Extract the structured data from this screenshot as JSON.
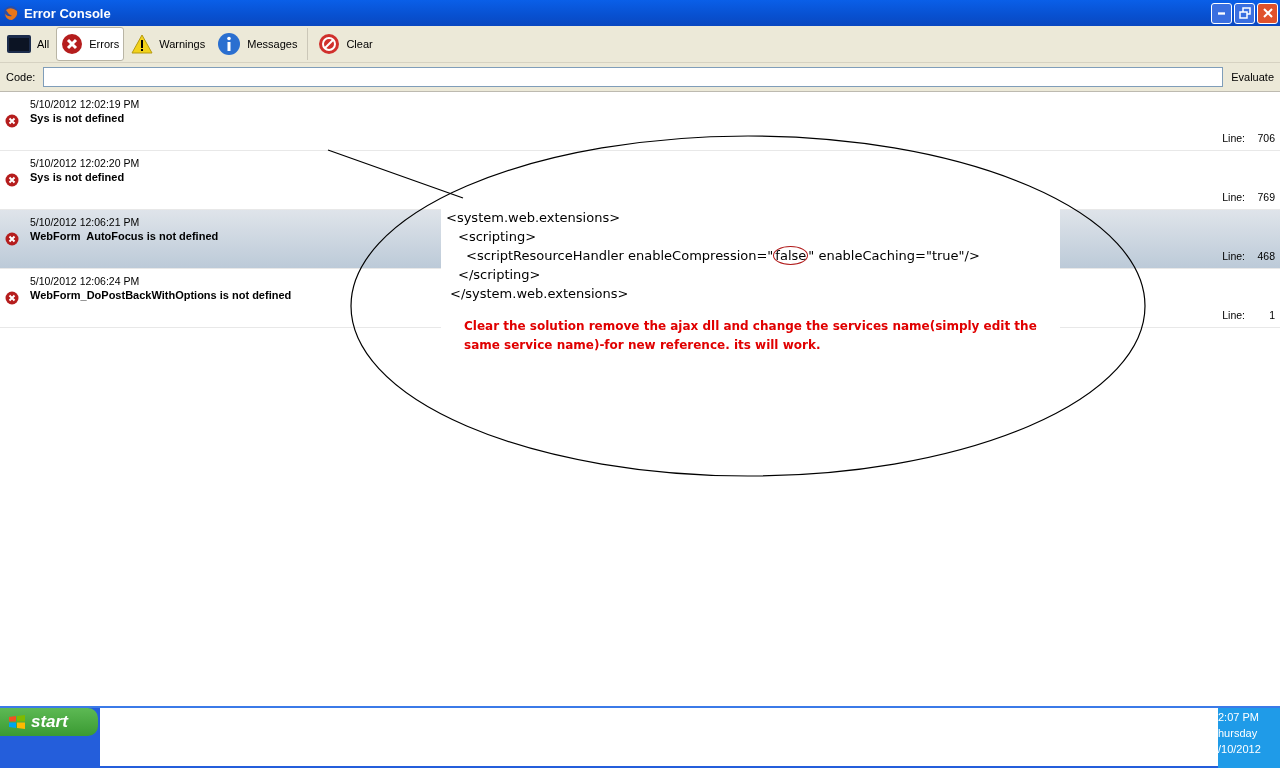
{
  "window": {
    "title": "Error Console"
  },
  "toolbar": [
    {
      "kind": "all",
      "label": "All",
      "selected": false
    },
    {
      "kind": "errors",
      "label": "Errors",
      "selected": true
    },
    {
      "kind": "warnings",
      "label": "Warnings",
      "selected": false
    },
    {
      "kind": "messages",
      "label": "Messages",
      "selected": false
    },
    {
      "kind": "clear",
      "label": "Clear",
      "selected": false
    }
  ],
  "code_bar": {
    "label": "Code:",
    "button": "Evaluate"
  },
  "messages": [
    {
      "time": "5/10/2012 12:02:19 PM",
      "text": "Sys is not defined",
      "line_label": "Line:",
      "line": "706",
      "selected": false
    },
    {
      "time": "5/10/2012 12:02:20 PM",
      "text": "Sys is not defined",
      "line_label": "Line:",
      "line": "769",
      "selected": false
    },
    {
      "time": "5/10/2012 12:06:21 PM",
      "text": "WebForm  AutoFocus is not defined",
      "line_label": "Line:",
      "line": "468",
      "selected": true
    },
    {
      "time": "5/10/2012 12:06:24 PM",
      "text": "WebForm_DoPostBackWithOptions is not defined",
      "line_label": "Line:",
      "line": "1",
      "selected": false
    }
  ],
  "annotation": {
    "code_lines": [
      [
        "<system.web.extensions>"
      ],
      [
        "<scripting>"
      ],
      [
        "<scriptResourceHandler enableCompression=\"",
        "false",
        "\" enableCaching=\"true\"/>"
      ],
      [
        "</scripting>"
      ],
      [
        "</system.web.extensions>"
      ]
    ],
    "note": "Clear the solution remove the ajax dll and change the services name(simply edit the same service name)-for new reference. its will work."
  },
  "taskbar": {
    "start": "start",
    "clock": [
      "2:07 PM",
      "hursday",
      "/10/2012"
    ]
  }
}
